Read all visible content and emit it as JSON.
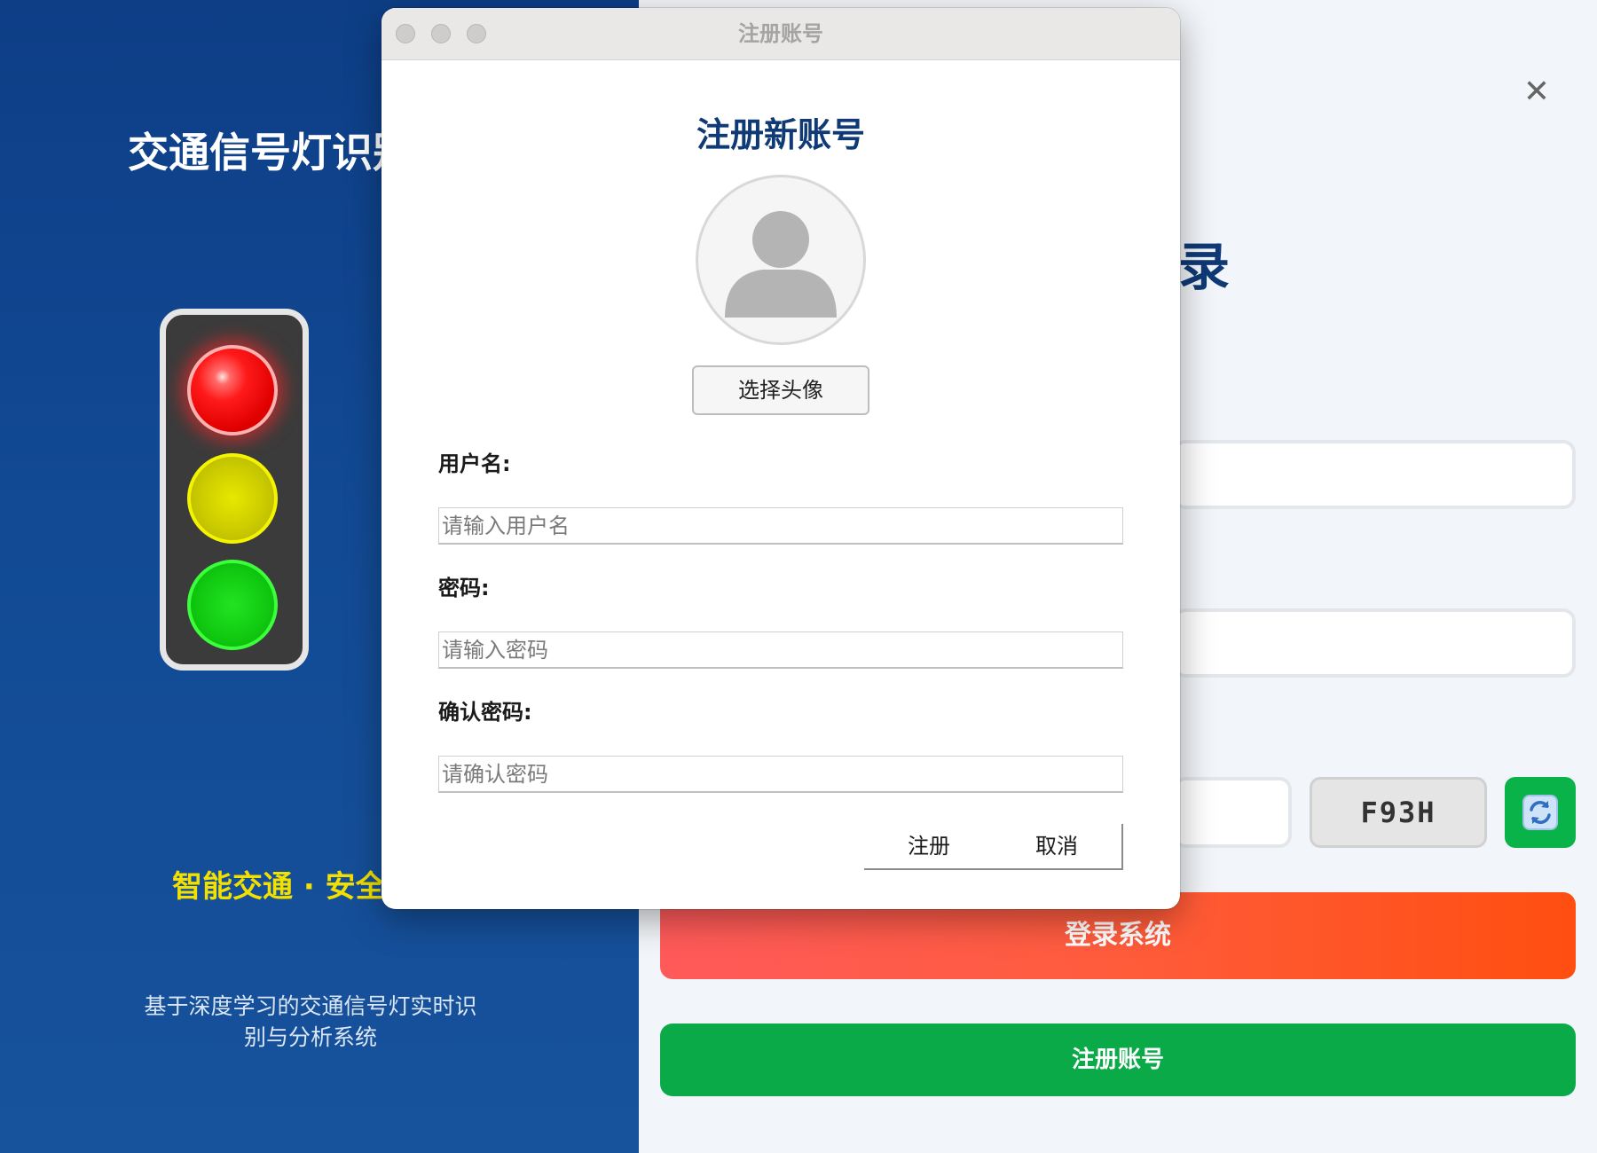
{
  "left_panel": {
    "title": "交通信号灯识别",
    "slogan": "智能交通 · 安全",
    "description": "基于深度学习的交通信号灯实时识别与分析系统"
  },
  "login_panel": {
    "heading_visible": "录",
    "close_symbol": "✕",
    "captcha_code": "F93H",
    "refresh_icon": "refresh-icon",
    "login_button": "登录系统",
    "register_button": "注册账号"
  },
  "dialog": {
    "window_title": "注册账号",
    "heading": "注册新账号",
    "avatar_icon": "user-silhouette-icon",
    "choose_avatar_button": "选择头像",
    "username": {
      "label": "用户名:",
      "placeholder": "请输入用户名",
      "value": ""
    },
    "password": {
      "label": "密码:",
      "placeholder": "请输入密码",
      "value": ""
    },
    "confirm_password": {
      "label": "确认密码:",
      "placeholder": "请确认密码",
      "value": ""
    },
    "submit_button": "注册",
    "cancel_button": "取消"
  },
  "colors": {
    "left_panel_bg": "#124a94",
    "heading_navy": "#0f3a75",
    "slogan_yellow": "#f2e000",
    "login_gradient_start": "#ff5a5a",
    "login_gradient_end": "#ff4e10",
    "register_green": "#0aaa48",
    "refresh_green": "#0ab34a"
  }
}
